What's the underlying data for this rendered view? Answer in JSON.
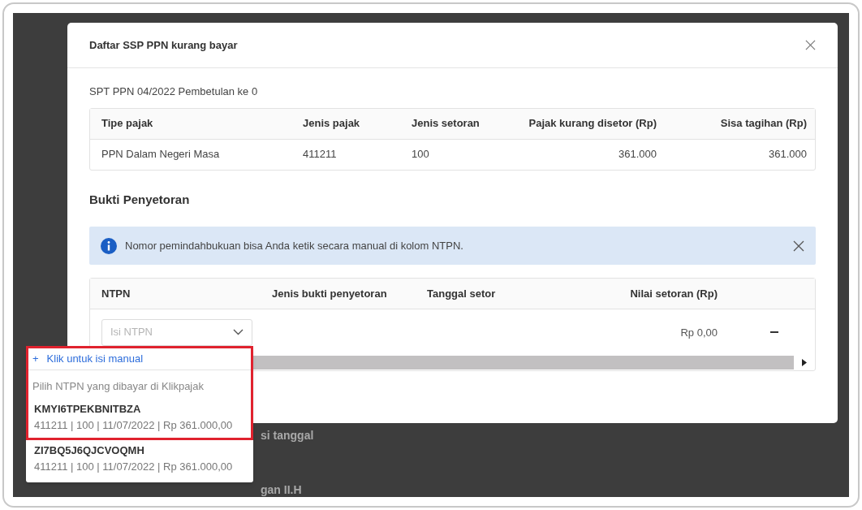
{
  "dialog": {
    "title": "Daftar SSP PPN kurang bayar",
    "subtitle": "SPT PPN 04/2022 Pembetulan ke 0",
    "tax_table": {
      "columns": [
        "Tipe pajak",
        "Jenis pajak",
        "Jenis setoran",
        "Pajak kurang disetor (Rp)",
        "Sisa tagihan (Rp)"
      ],
      "rows": [
        [
          "PPN Dalam Negeri Masa",
          "411211",
          "100",
          "361.000",
          "361.000"
        ]
      ]
    },
    "section_title": "Bukti Penyetoran",
    "info_banner": {
      "text": "Nomor pemindahbukuan bisa Anda ketik secara manual di kolom NTPN."
    },
    "payment_table": {
      "columns": [
        "NTPN",
        "Jenis bukti penyetoran",
        "Tanggal setor",
        "Nilai setoran (Rp)"
      ],
      "rows": [
        {
          "ntpn_placeholder": "Isi NTPN",
          "amount": "Rp 0,00"
        }
      ]
    }
  },
  "dropdown": {
    "manual_option": {
      "icon": "+",
      "label": "Klik untuk isi manual"
    },
    "group_label": "Pilih NTPN yang dibayar di Klikpajak",
    "options": [
      {
        "code": "KMYI6TPEKBNITBZA",
        "details": "411211 | 100 | 11/07/2022 | Rp 361.000,00",
        "highlighted": true
      },
      {
        "code": "ZI7BQ5J6QJCVOQMH",
        "details": "411211 | 100 | 11/07/2022 | Rp 361.000,00",
        "highlighted": false
      }
    ]
  },
  "background": {
    "texts": [
      "si tanggal",
      "gan II.H"
    ]
  }
}
